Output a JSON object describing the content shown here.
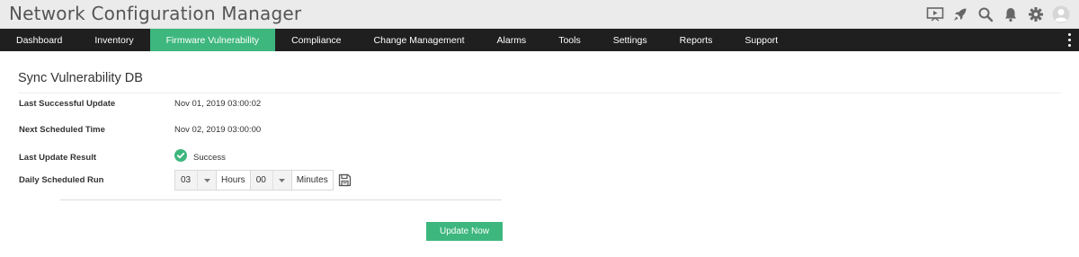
{
  "app": {
    "title": "Network Configuration Manager"
  },
  "header_icons": [
    "presentation-icon",
    "rocket-icon",
    "search-icon",
    "bell-icon",
    "gear-icon",
    "user-avatar-icon"
  ],
  "nav": {
    "items": [
      {
        "label": "Dashboard",
        "active": false
      },
      {
        "label": "Inventory",
        "active": false
      },
      {
        "label": "Firmware Vulnerability",
        "active": true
      },
      {
        "label": "Compliance",
        "active": false
      },
      {
        "label": "Change Management",
        "active": false
      },
      {
        "label": "Alarms",
        "active": false
      },
      {
        "label": "Tools",
        "active": false
      },
      {
        "label": "Settings",
        "active": false
      },
      {
        "label": "Reports",
        "active": false
      },
      {
        "label": "Support",
        "active": false
      }
    ]
  },
  "page": {
    "title": "Sync Vulnerability DB",
    "last_update_label": "Last Successful Update",
    "last_update_value": "Nov 01, 2019 03:00:02",
    "next_time_label": "Next Scheduled Time",
    "next_time_value": "Nov 02, 2019 03:00:00",
    "result_label": "Last Update Result",
    "result_value": "Success",
    "daily_run_label": "Daily Scheduled Run",
    "hours_value": "03",
    "hours_unit": "Hours",
    "minutes_value": "00",
    "minutes_unit": "Minutes",
    "update_button": "Update Now"
  },
  "colors": {
    "accent": "#3db77e",
    "nav_bg": "#1f1f1f",
    "header_bg": "#ebebeb"
  }
}
